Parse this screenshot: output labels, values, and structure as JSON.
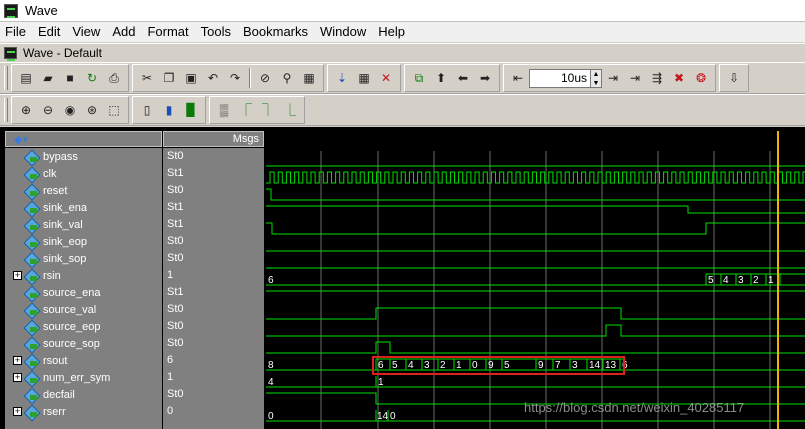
{
  "window": {
    "title": "Wave",
    "sub_title": "Wave - Default"
  },
  "menu": [
    "File",
    "Edit",
    "View",
    "Add",
    "Format",
    "Tools",
    "Bookmarks",
    "Window",
    "Help"
  ],
  "toolbar": {
    "time_value": "10us"
  },
  "header": {
    "msgs_label": "Msgs"
  },
  "signals": [
    {
      "name": "bypass",
      "value": "St0",
      "bus": false
    },
    {
      "name": "clk",
      "value": "St1",
      "bus": false
    },
    {
      "name": "reset",
      "value": "St0",
      "bus": false
    },
    {
      "name": "sink_ena",
      "value": "St1",
      "bus": false
    },
    {
      "name": "sink_val",
      "value": "St1",
      "bus": false
    },
    {
      "name": "sink_eop",
      "value": "St0",
      "bus": false
    },
    {
      "name": "sink_sop",
      "value": "St0",
      "bus": false
    },
    {
      "name": "rsin",
      "value": "1",
      "bus": true
    },
    {
      "name": "source_ena",
      "value": "St1",
      "bus": false
    },
    {
      "name": "source_val",
      "value": "St0",
      "bus": false
    },
    {
      "name": "source_eop",
      "value": "St0",
      "bus": false
    },
    {
      "name": "source_sop",
      "value": "St0",
      "bus": false
    },
    {
      "name": "rsout",
      "value": "6",
      "bus": true
    },
    {
      "name": "num_err_sym",
      "value": "1",
      "bus": true
    },
    {
      "name": "decfail",
      "value": "St0",
      "bus": false
    },
    {
      "name": "rserr",
      "value": "0",
      "bus": true
    }
  ],
  "bus_labels": {
    "rsin_start": "6",
    "rsin_tail": [
      "5",
      "4",
      "3",
      "2",
      "1"
    ],
    "rsout_start": "8",
    "rsout_seq": [
      "6",
      "5",
      "4",
      "3",
      "2",
      "1",
      "0",
      "9",
      "5",
      "9",
      "7",
      "3",
      "14",
      "13",
      "6"
    ],
    "num_err_sym_start": "4",
    "num_err_sym_next": "1",
    "rserr_start": "0",
    "rserr_next": "14",
    "rserr_tail": "0"
  },
  "colors": {
    "wave": "#00e000",
    "cursor": "#f0b400",
    "highlight": "#e02020",
    "grid": "#6b6b6b"
  },
  "watermark": "https://blog.csdn.net/weixin_40285117"
}
